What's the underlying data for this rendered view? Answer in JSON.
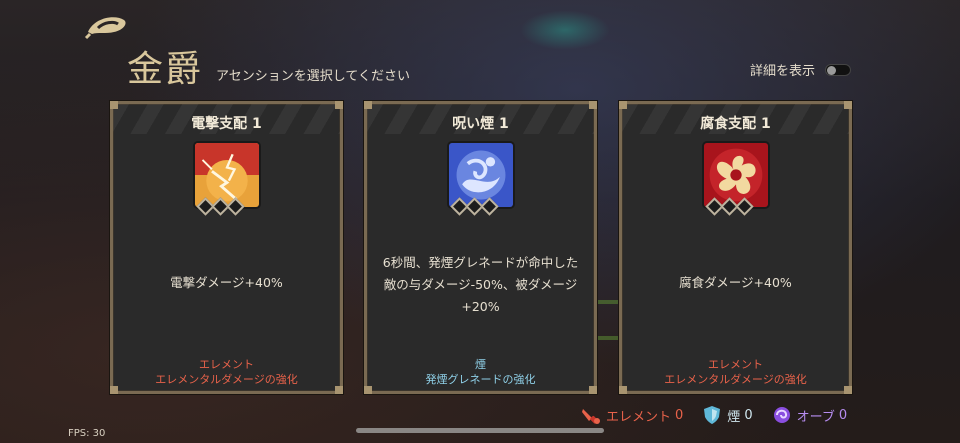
{
  "header": {
    "title": "金爵",
    "subtitle": "アセンションを選択してください",
    "details_label": "詳細を表示",
    "details_toggle": false
  },
  "cards": [
    {
      "name": "電撃支配 1",
      "icon": "lightning-icon",
      "level_filled": 0,
      "description": "電撃ダメージ+40%",
      "category": "エレメント",
      "category_effect": "エレメンタルダメージの強化",
      "accent": "#e8624a"
    },
    {
      "name": "呪い煙 1",
      "icon": "curse-smoke-icon",
      "level_filled": 0,
      "description": "6秒間、発煙グレネードが命中した敵の与ダメージ-50%、被ダメージ+20%",
      "category": "煙",
      "category_effect": "発煙グレネードの強化",
      "accent": "#8fd0e8"
    },
    {
      "name": "腐食支配 1",
      "icon": "corrosion-icon",
      "level_filled": 0,
      "description": "腐食ダメージ+40%",
      "category": "エレメント",
      "category_effect": "エレメンタルダメージの強化",
      "accent": "#e8624a"
    }
  ],
  "resources": {
    "element_label": "エレメント",
    "element_count": "0",
    "smoke_label": "煙",
    "smoke_count": "0",
    "orb_label": "オーブ",
    "orb_count": "0"
  },
  "fps": "FPS: 30"
}
